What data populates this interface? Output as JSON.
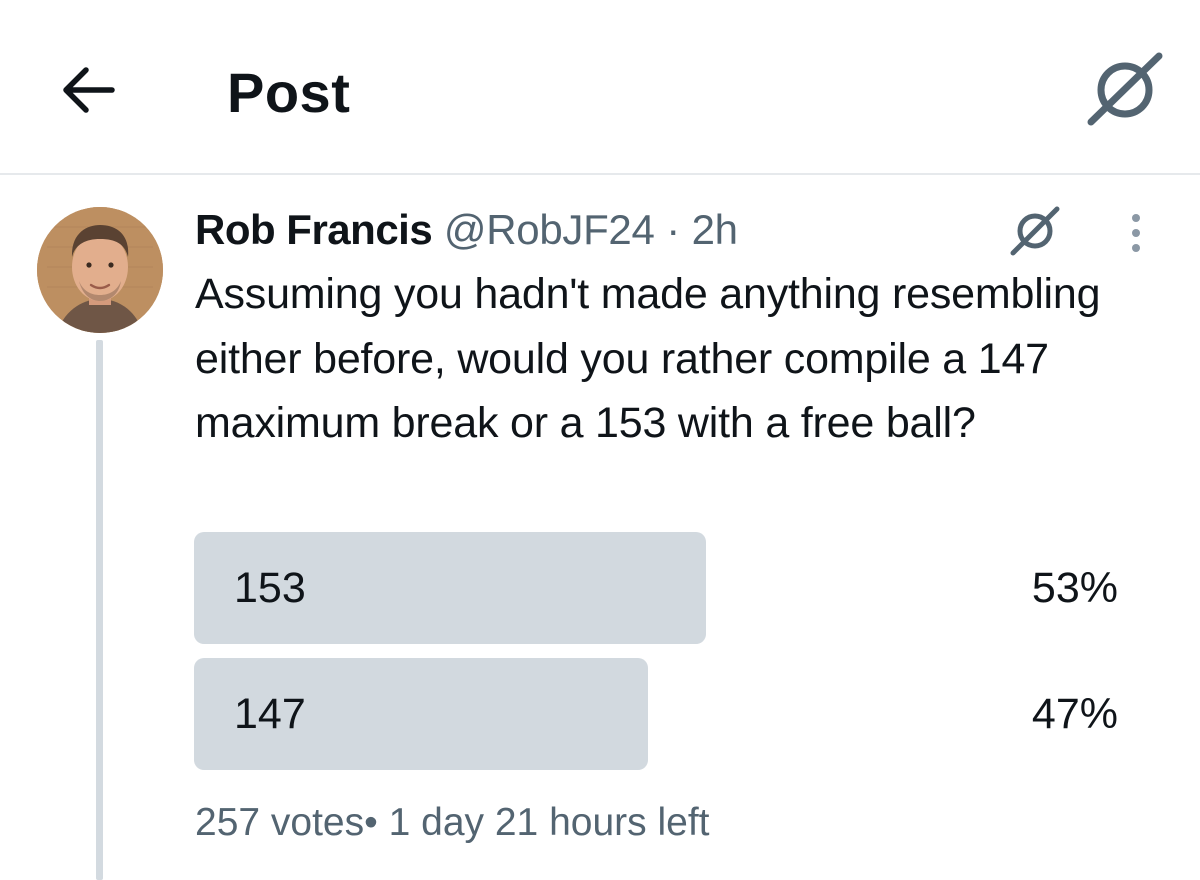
{
  "header": {
    "title": "Post",
    "back_icon": "arrow-left-icon",
    "grok_icon": "grok-icon"
  },
  "post": {
    "author_name": "Rob Francis",
    "handle": "@RobJF24",
    "separator": "·",
    "time": "2h",
    "text": "Assuming you hadn't made anything resembling either before, would you rather compile a 147 maximum break or a 153 with a free ball?",
    "avatar": "avatar",
    "grok_icon": "grok-icon",
    "more_icon": "more-vertical-icon"
  },
  "poll": {
    "options": [
      {
        "label": "153",
        "percent_text": "53%",
        "percent": 53
      },
      {
        "label": "147",
        "percent_text": "47%",
        "percent": 47
      }
    ],
    "votes": "257 votes",
    "footer_sep": "•",
    "time_left": "1 day 21 hours left"
  },
  "colors": {
    "bar": "#d2d9df",
    "secondary_text": "#536471",
    "primary_text": "#0f1419",
    "divider": "#e6e9ec"
  }
}
